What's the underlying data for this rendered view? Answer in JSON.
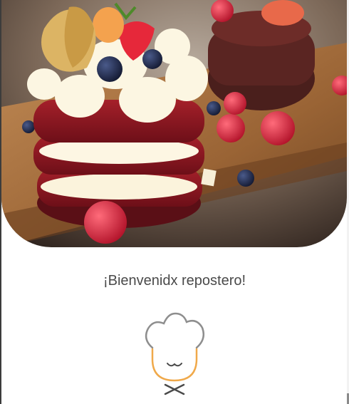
{
  "hero": {
    "image_subject": "cake-photo"
  },
  "welcome": {
    "text": "¡Bienvenidx repostero!"
  },
  "logo": {
    "icon": "chef-hat-icon",
    "colors": {
      "hat": "#8e8e8e",
      "face": "#f0a94a",
      "bowtie": "#4a4a4a"
    }
  }
}
